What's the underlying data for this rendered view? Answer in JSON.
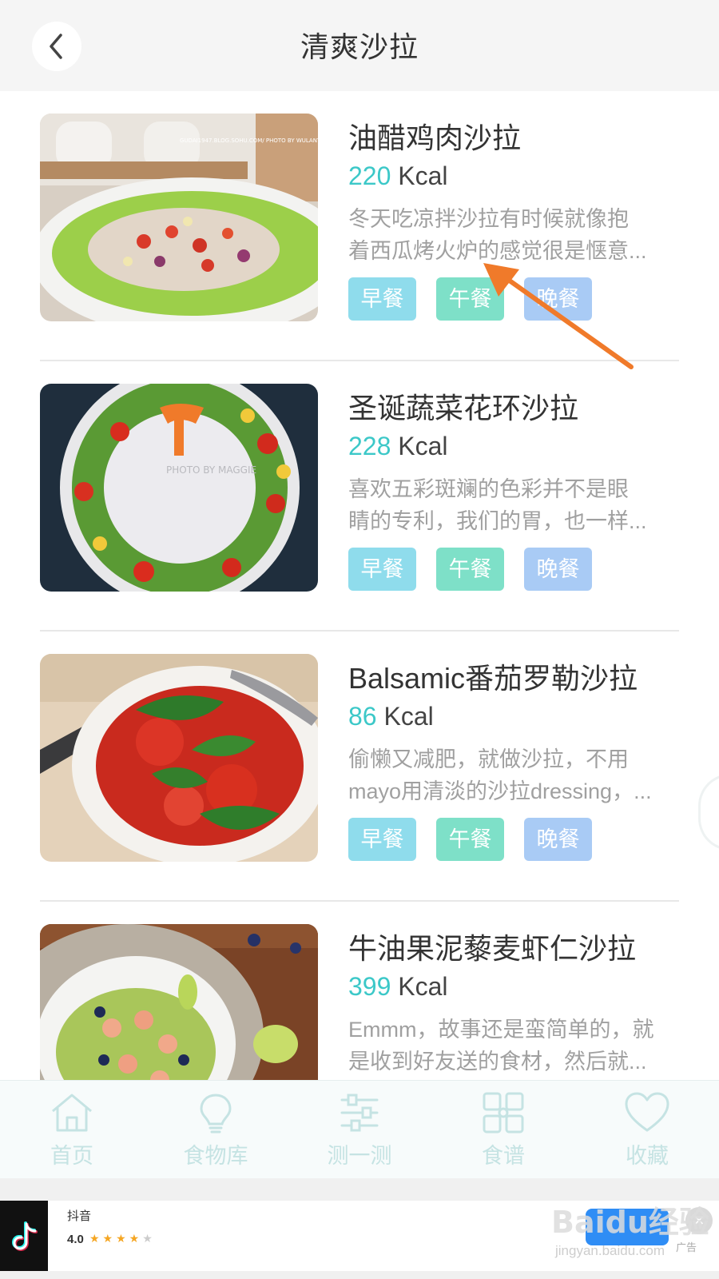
{
  "header": {
    "title": "清爽沙拉",
    "back_icon": "chevron-left-icon"
  },
  "recipes": [
    {
      "title": "油醋鸡肉沙拉",
      "kcal_value": "220",
      "kcal_unit": "Kcal",
      "desc_line1": "冬天吃凉拌沙拉有时候就像抱",
      "desc_line2": "着西瓜烤火炉的感觉很是惬意...",
      "tags": [
        "早餐",
        "午餐",
        "晚餐"
      ],
      "image_watermark": "GUDAI1947.BLOG.SOHU.COM/ PHOTO BY WULANTUYA"
    },
    {
      "title": "圣诞蔬菜花环沙拉",
      "kcal_value": "228",
      "kcal_unit": "Kcal",
      "desc_line1": "喜欢五彩斑斓的色彩并不是眼",
      "desc_line2": "睛的专利，我们的胃，也一样...",
      "tags": [
        "早餐",
        "午餐",
        "晚餐"
      ],
      "image_watermark": "PHOTO BY MAGGIE"
    },
    {
      "title": "Balsamic番茄罗勒沙拉",
      "kcal_value": "86",
      "kcal_unit": "Kcal",
      "desc_line1": "偷懒又减肥，就做沙拉，不用",
      "desc_line2": "mayo用清淡的沙拉dressing，...",
      "tags": [
        "早餐",
        "午餐",
        "晚餐"
      ]
    },
    {
      "title": "牛油果泥藜麦虾仁沙拉",
      "kcal_value": "399",
      "kcal_unit": "Kcal",
      "desc_line1": "Emmm，故事还是蛮简单的，就",
      "desc_line2": "是收到好友送的食材，然后就..."
    }
  ],
  "tabbar": {
    "items": [
      {
        "label": "首页",
        "icon": "home-icon"
      },
      {
        "label": "食物库",
        "icon": "lightbulb-icon"
      },
      {
        "label": "测一测",
        "icon": "sliders-icon"
      },
      {
        "label": "食谱",
        "icon": "grid-icon"
      },
      {
        "label": "收藏",
        "icon": "heart-icon"
      }
    ]
  },
  "ad": {
    "app_name": "抖音",
    "rating": "4.0",
    "stars": "★★★★",
    "star_empty": "★",
    "label": "广告",
    "close": "×"
  },
  "watermark": {
    "main": "Baidu经验",
    "sub": "jingyan.baidu.com"
  },
  "colors": {
    "accent_teal": "#3cc8c8",
    "annotation_arrow": "#f07a2a",
    "tag_breakfast": "#8fdcec",
    "tag_lunch": "#7ee0c8",
    "tag_dinner": "#a9cbf5"
  }
}
